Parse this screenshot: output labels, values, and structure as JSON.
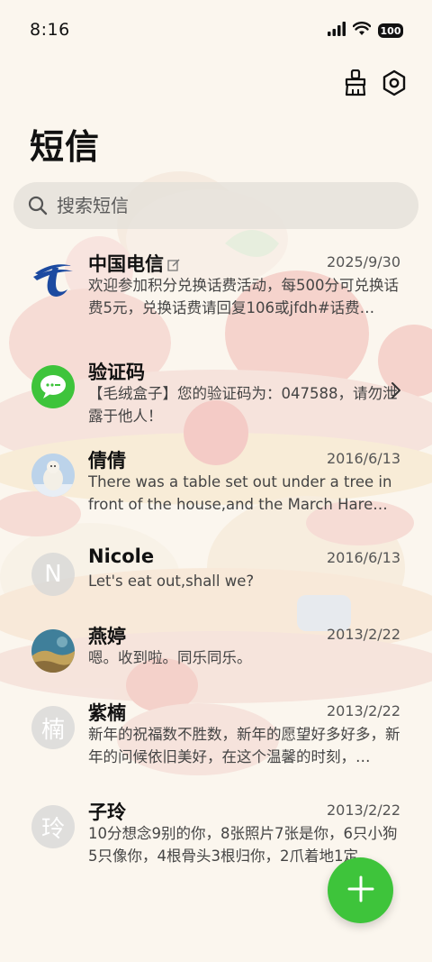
{
  "status_bar": {
    "time": "8:16",
    "battery": "100"
  },
  "header": {
    "title": "短信"
  },
  "search": {
    "placeholder": "搜索短信"
  },
  "conversations": [
    {
      "name": "中国电信",
      "date": "2025/9/30",
      "preview": "欢迎参加积分兑换话费活动，每500分可兑换话费5元，兑换话费请回复106或jfdh#话费…",
      "avatar": "telecom-logo"
    },
    {
      "name": "验证码",
      "date": "",
      "preview": "【毛绒盒子】您的验证码为：047588，请勿泄露于他人！",
      "avatar": "message-bubble"
    },
    {
      "name": "倩倩",
      "date": "2016/6/13",
      "preview": "There was a table set out under a tree in front of the house,and the March Hare an…",
      "avatar": "photo-polar-bear"
    },
    {
      "name": "Nicole",
      "date": "2016/6/13",
      "preview": "Let's eat out,shall we?",
      "avatar_letter": "N"
    },
    {
      "name": "燕婷",
      "date": "2013/2/22",
      "preview": "嗯。收到啦。同乐同乐。",
      "avatar": "photo-landscape"
    },
    {
      "name": "紫楠",
      "date": "2013/2/22",
      "preview": "新年的祝福数不胜数，新年的愿望好多好多，新年的问候依旧美好，在这个温馨的时刻，…",
      "avatar_letter": "楠"
    },
    {
      "name": "子玲",
      "date": "2013/2/22",
      "preview": "10分想念9别的你，8张照片7张是你，6只小狗5只像你，4根骨头3根归你，2爪着地1定…",
      "avatar_letter": "玲"
    }
  ],
  "colors": {
    "accent": "#3ec43b",
    "background": "#fbf6ee",
    "telecom_blue": "#1c4aa0"
  }
}
